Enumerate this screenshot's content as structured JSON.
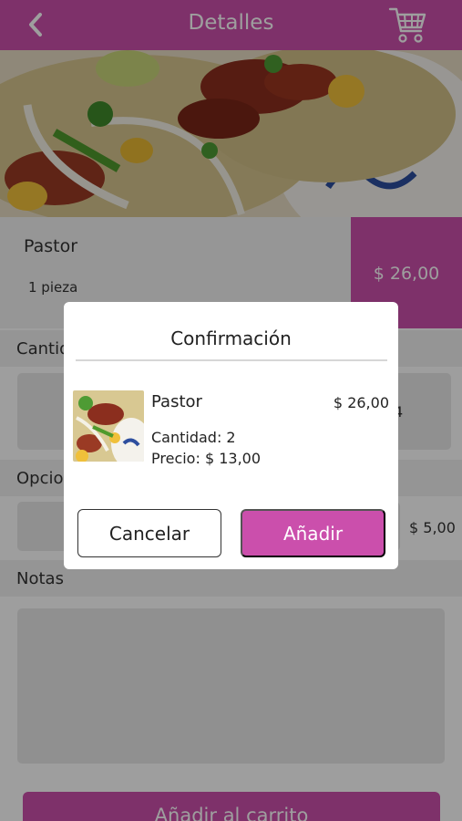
{
  "header": {
    "title": "Detalles",
    "back_icon": "chevron-left-icon",
    "cart_icon": "shopping-cart-icon",
    "color": "#cb4fac"
  },
  "product": {
    "name": "Pastor",
    "pieces": "1 pieza",
    "price": "$ 26,00"
  },
  "sections": {
    "quantity_label": "Cantidad",
    "quantity_value": "4",
    "options_label": "Opciones",
    "options_price": "$ 5,00",
    "notes_label": "Notas"
  },
  "add_button_label": "Añadir al carrito",
  "dialog": {
    "title": "Confirmación",
    "item_name": "Pastor",
    "item_price": "$ 26,00",
    "quantity": "Cantidad: 2",
    "unit_price": "Precio: $ 13,00",
    "cancel_label": "Cancelar",
    "confirm_label": "Añadir"
  }
}
